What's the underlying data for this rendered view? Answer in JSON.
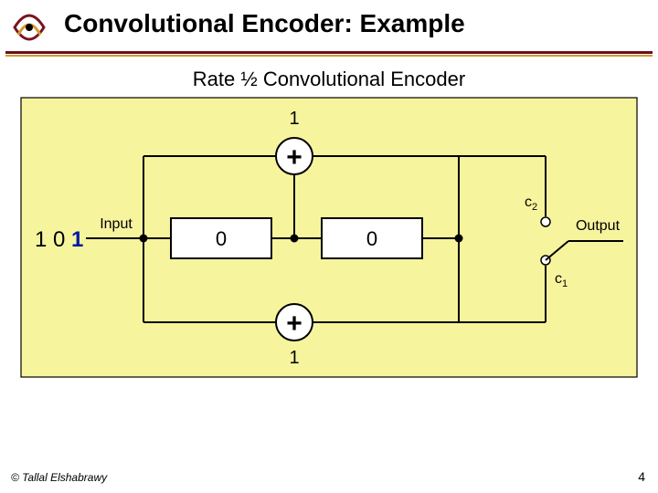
{
  "title": "Convolutional Encoder: Example",
  "subtitle": "Rate ½ Convolutional Encoder",
  "input_label": "Input",
  "output_label": "Output",
  "input_bits": {
    "b0": "1",
    "b1": "0",
    "b2": "1"
  },
  "register": {
    "r0": "0",
    "r1": "0"
  },
  "adder_top": {
    "symbol": "+",
    "value": "1"
  },
  "adder_bot": {
    "symbol": "+",
    "value": "1"
  },
  "out_tap_top": "c",
  "out_tap_top_sub": "2",
  "out_tap_bot": "c",
  "out_tap_bot_sub": "1",
  "footer": "© Tallal Elshabrawy",
  "page": "4"
}
